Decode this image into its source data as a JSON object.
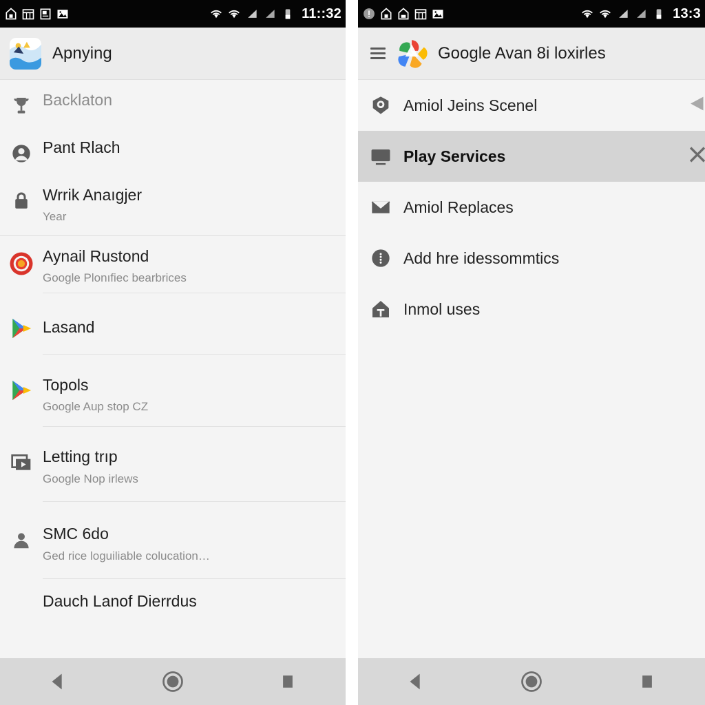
{
  "left_phone": {
    "status_bar": {
      "time": "11::32",
      "notification_icons": [
        "home-notification-icon",
        "calendar-notification-icon",
        "news-notification-icon",
        "photo-notification-icon"
      ],
      "system_icons": [
        "wifi-icon",
        "wifi-icon",
        "signal-icon",
        "signal-icon",
        "battery-icon"
      ]
    },
    "app_bar": {
      "title": "Apnying",
      "icon": "gallery-app-icon"
    },
    "items": [
      {
        "icon": "trophy-icon",
        "title": "Backlaton",
        "subtitle": "",
        "muted": true,
        "divider": false,
        "section_end": false
      },
      {
        "icon": "account-icon",
        "title": "Pant Rlach",
        "subtitle": "",
        "muted": false,
        "divider": false,
        "section_end": false
      },
      {
        "icon": "lock-icon",
        "title": "Wrrik Anaıgjer",
        "subtitle": "Year",
        "muted": false,
        "divider": false,
        "section_end": true
      },
      {
        "icon": "target-icon",
        "title": "Aynail Rustond",
        "subtitle": "Google Plonıfiec bearbrices",
        "muted": false,
        "divider": true,
        "section_end": false
      },
      {
        "icon": "play-store-icon",
        "title": "Lasand",
        "subtitle": "",
        "muted": false,
        "divider": true,
        "section_end": false
      },
      {
        "icon": "play-store-icon",
        "title": "Topols",
        "subtitle": "Google Aup stop CZ",
        "muted": false,
        "divider": true,
        "section_end": false
      },
      {
        "icon": "media-icon",
        "title": "Letting trıp",
        "subtitle": "Google Nop irlews",
        "muted": false,
        "divider": true,
        "section_end": false
      },
      {
        "icon": "person-icon",
        "title": "SMC 6do",
        "subtitle": "Ged rice loguiliable colucation…",
        "muted": false,
        "divider": true,
        "section_end": false
      },
      {
        "icon": "",
        "title": "Dauch Lanof Dierrdus",
        "subtitle": "",
        "muted": false,
        "divider": false,
        "section_end": false
      }
    ],
    "nav_bar": {
      "back": "back-button",
      "home": "home-button",
      "recents": "recents-button"
    }
  },
  "right_phone": {
    "status_bar": {
      "time": "13:3",
      "notification_icons": [
        "info-notification-icon",
        "home-notification-icon",
        "home-notification-icon",
        "calendar-notification-icon",
        "photo-notification-icon"
      ],
      "system_icons": [
        "wifi-icon",
        "wifi-icon",
        "signal-icon",
        "signal-icon",
        "battery-icon"
      ]
    },
    "app_bar": {
      "menu": "hamburger-menu",
      "logo": "google-photos-pinwheel-icon",
      "title": "Google Avan 8i loxirles"
    },
    "items": [
      {
        "icon": "shield-icon",
        "title": "Amiol Jeins Scenel",
        "selected": false,
        "edge": "left-triangle"
      },
      {
        "icon": "monitor-icon",
        "title": "Play Services",
        "selected": true,
        "edge": "x-mark"
      },
      {
        "icon": "mail-icon",
        "title": "Amiol Replaces",
        "selected": false,
        "edge": ""
      },
      {
        "icon": "info-icon",
        "title": "Add hre idessommtics",
        "selected": false,
        "edge": ""
      },
      {
        "icon": "home-icon",
        "title": "Inmol uses",
        "selected": false,
        "edge": ""
      }
    ],
    "nav_bar": {
      "back": "back-button",
      "home": "home-button",
      "recents": "recents-button"
    }
  },
  "colors": {
    "status_bar_bg": "#050505",
    "app_bar_bg": "#ececec",
    "list_bg": "#f4f4f4",
    "selected_row_bg": "#d4d4d4",
    "nav_bar_bg": "#d8d8d8",
    "title_text": "#1f1f1f",
    "subtitle_text": "#8b8b8b",
    "icon_gray": "#5c5c5c"
  }
}
